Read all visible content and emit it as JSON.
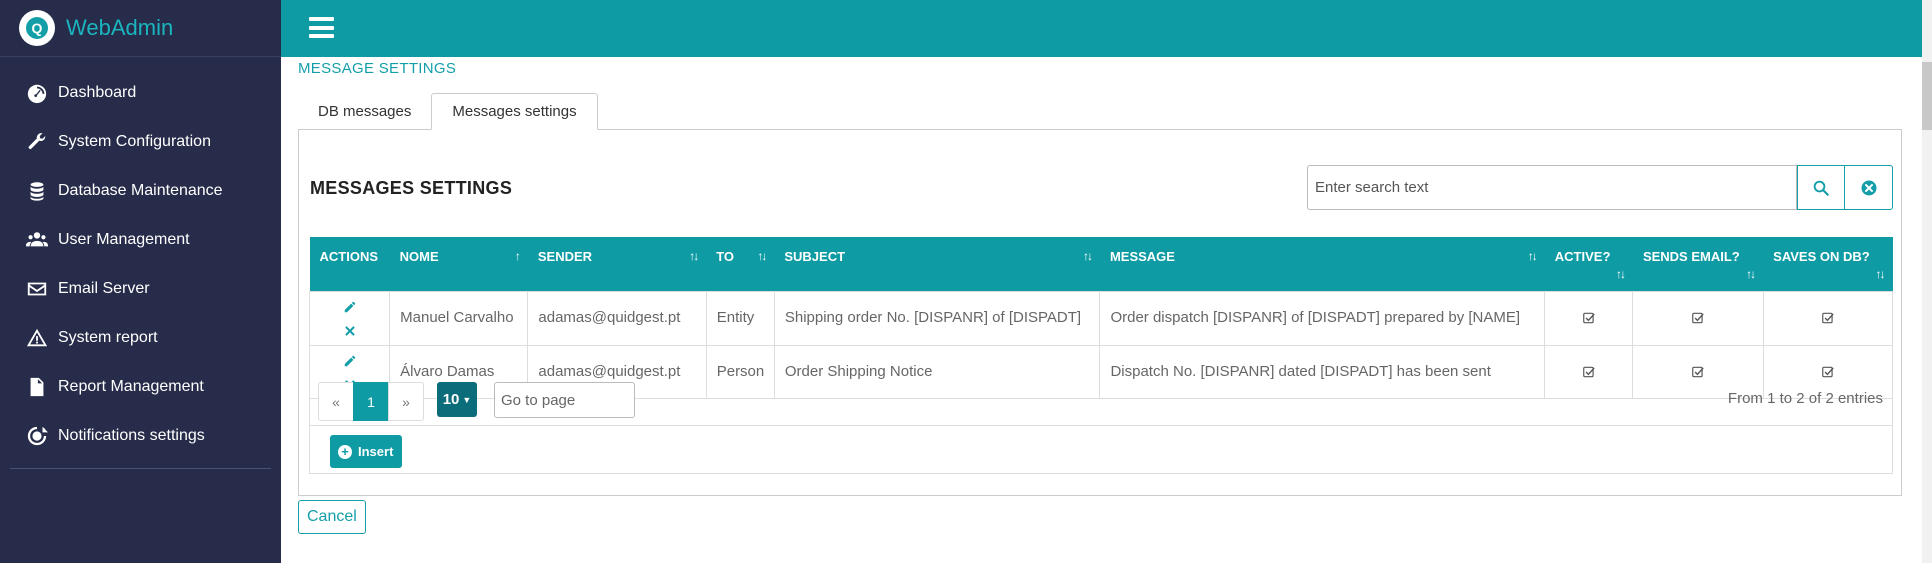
{
  "app": {
    "name": "WebAdmin",
    "logo_letter": "Q"
  },
  "sidebar": {
    "items": [
      {
        "label": "Dashboard",
        "icon": "dashboard-icon"
      },
      {
        "label": "System Configuration",
        "icon": "wrench-icon"
      },
      {
        "label": "Database Maintenance",
        "icon": "database-icon"
      },
      {
        "label": "User Management",
        "icon": "users-icon"
      },
      {
        "label": "Email Server",
        "icon": "envelope-icon"
      },
      {
        "label": "System report",
        "icon": "warning-icon"
      },
      {
        "label": "Report Management",
        "icon": "file-icon"
      },
      {
        "label": "Notifications settings",
        "icon": "notifications-icon"
      }
    ]
  },
  "page": {
    "title": "MESSAGE SETTINGS"
  },
  "tabs": [
    {
      "label": "DB messages",
      "active": false
    },
    {
      "label": "Messages settings",
      "active": true
    }
  ],
  "panel": {
    "title": "MESSAGES SETTINGS",
    "search": {
      "placeholder": "Enter search text"
    }
  },
  "table": {
    "columns": [
      "ACTIONS",
      "NOME",
      "SENDER",
      "TO",
      "SUBJECT",
      "MESSAGE",
      "ACTIVE?",
      "SENDS EMAIL?",
      "SAVES ON DB?"
    ],
    "rows": [
      {
        "nome": "Manuel Carvalho",
        "sender": "adamas@quidgest.pt",
        "to": "Entity",
        "subject": "Shipping order No. [DISPANR] of [DISPADT]",
        "message": "Order dispatch [DISPANR] of [DISPADT] prepared by [NAME]",
        "active": true,
        "sends_email": true,
        "saves_on_db": true
      },
      {
        "nome": "Álvaro Damas",
        "sender": "adamas@quidgest.pt",
        "to": "Person",
        "subject": "Order Shipping Notice",
        "message": "Dispatch No. [DISPANR] dated [DISPADT] has been sent",
        "active": true,
        "sends_email": true,
        "saves_on_db": true
      }
    ]
  },
  "pagination": {
    "prev": "«",
    "current": "1",
    "next": "»",
    "page_size": "10",
    "goto_placeholder": "Go to page",
    "entries_text": "From 1 to 2 of 2 entries"
  },
  "buttons": {
    "insert": "Insert",
    "cancel": "Cancel"
  },
  "colors": {
    "accent": "#0e9ba4",
    "sidebar_bg": "#262c49",
    "brand_text": "#1ab5bf",
    "page_size_bg": "#0c6d7a"
  }
}
